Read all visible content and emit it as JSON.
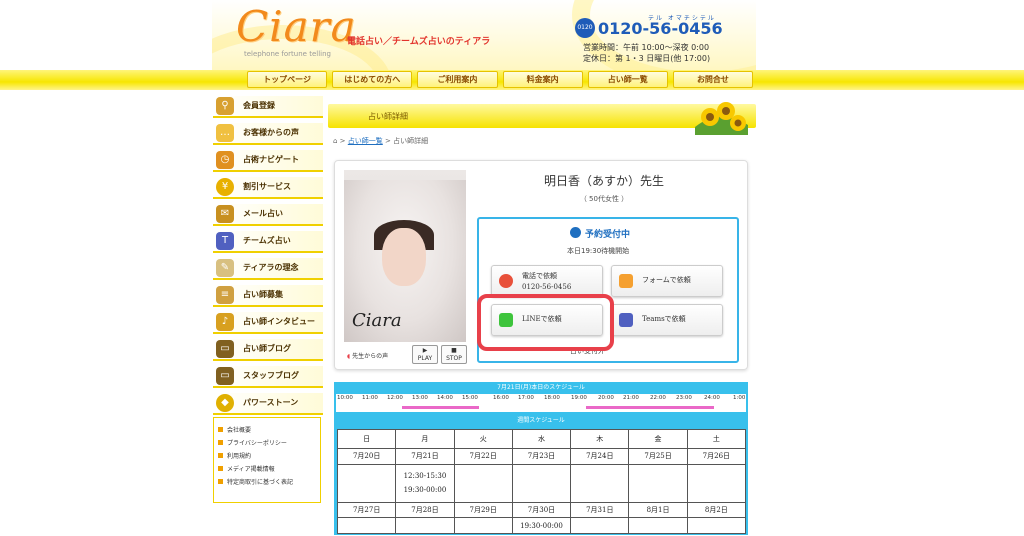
{
  "header": {
    "logo_text": "Ciara",
    "logo_sub": "telephone fortune telling",
    "tagline": "電話占い／チームズ占いのティアラ",
    "phone_badge": "0120",
    "phone_ruby": "テル オマチシテル",
    "phone_number": "0120-56-0456",
    "hours_line1": "営業時間：午前 10:00〜深夜 0:00",
    "hours_line2": "定休日：第 1・3 日曜日(他 17:00)"
  },
  "nav": [
    "トップページ",
    "はじめての方へ",
    "ご利用案内",
    "料金案内",
    "占い師一覧",
    "お問合せ"
  ],
  "sidebar": {
    "items": [
      {
        "label": "会員登録",
        "icon": "magnifier-icon",
        "color": "#d8a030"
      },
      {
        "label": "お客様からの声",
        "icon": "speech-bubble-icon",
        "color": "#f0c040"
      },
      {
        "label": "占術ナビゲート",
        "icon": "clock-icon",
        "color": "#e09020"
      },
      {
        "label": "割引サービス",
        "icon": "yen-icon",
        "color": "#e8b000"
      },
      {
        "label": "メール占い",
        "icon": "envelope-icon",
        "color": "#c89020"
      },
      {
        "label": "チームズ占い",
        "icon": "teams-icon",
        "color": "#5060c0"
      },
      {
        "label": "ティアラの理念",
        "icon": "quill-icon",
        "color": "#d8c080"
      },
      {
        "label": "占い師募集",
        "icon": "scroll-icon",
        "color": "#d0a040"
      },
      {
        "label": "占い師インタビュー",
        "icon": "microphone-icon",
        "color": "#d8a020"
      },
      {
        "label": "占い師ブログ",
        "icon": "monitor-icon",
        "color": "#806020"
      },
      {
        "label": "スタッフブログ",
        "icon": "monitor-icon",
        "color": "#806020"
      },
      {
        "label": "パワーストーン",
        "icon": "gem-icon",
        "color": "#e0b000"
      }
    ],
    "links": [
      "会社概要",
      "プライバシーポリシー",
      "利用規約",
      "メディア掲載情報",
      "特定商取引に基づく表記"
    ]
  },
  "main": {
    "section_title": "占い師詳細",
    "breadcrumb": {
      "sep1": " > ",
      "link": "占い師一覧",
      "sep2": " > ",
      "current": "占い師詳細"
    },
    "name": "明日香（あすか）先生",
    "age": "（ 50代女性 ）",
    "photo_logo": "Ciara",
    "voice_label": "先生からの声",
    "play_label": "PLAY",
    "stop_label": "STOP",
    "reservation": {
      "title": "予約受付中",
      "subtitle": "本日19:30待機開始",
      "phone_label": "電話で依頼",
      "phone_number": "0120-56-0456",
      "form_label": "フォームで依頼",
      "line_label": "LINEで依頼",
      "teams_label": "Teamsで依頼",
      "note": "占い受付外"
    }
  },
  "schedule": {
    "day_header": "7月21日(月)本日のスケジュール",
    "times": [
      "10:00",
      "11:00",
      "12:00",
      "13:00",
      "14:00",
      "15:00",
      "16:00",
      "17:00",
      "18:00",
      "19:00",
      "20:00",
      "21:00",
      "22:00",
      "23:00",
      "24:00",
      "1:00"
    ],
    "week_header": "週間スケジュール",
    "weekdays": [
      "日",
      "月",
      "火",
      "水",
      "木",
      "金",
      "土"
    ],
    "week1_dates": [
      "7月20日",
      "7月21日",
      "7月22日",
      "7月23日",
      "7月24日",
      "7月25日",
      "7月26日"
    ],
    "week1_times": [
      "",
      "12:30-15:30",
      "",
      "",
      "",
      "",
      ""
    ],
    "week1_times2": [
      "",
      "19:30-00:00",
      "",
      "",
      "",
      "",
      ""
    ],
    "week2_dates": [
      "7月27日",
      "7月28日",
      "7月29日",
      "7月30日",
      "7月31日",
      "8月1日",
      "8月2日"
    ],
    "week2_times": [
      "",
      "",
      "",
      "19:30-00:00",
      "",
      "",
      ""
    ]
  },
  "colors": {
    "accent_yellow": "#f7e600",
    "schedule_blue": "#38c0ec",
    "highlight_red": "#e8404a",
    "link_blue": "#1f6fc0"
  }
}
